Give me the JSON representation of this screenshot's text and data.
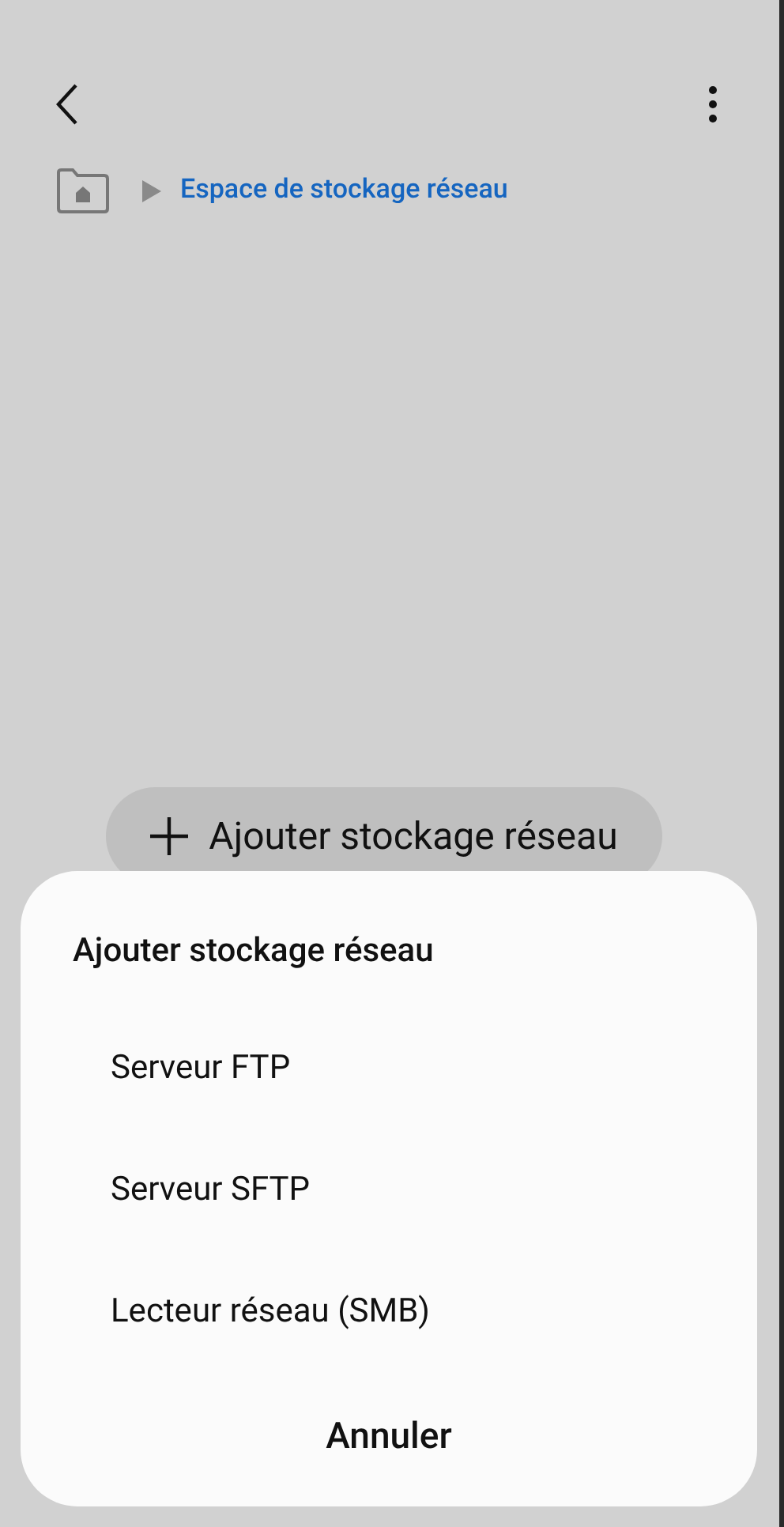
{
  "breadcrumb": {
    "current": "Espace de stockage réseau"
  },
  "add_button": {
    "label": "Ajouter stockage réseau"
  },
  "sheet": {
    "title": "Ajouter stockage réseau",
    "options": [
      "Serveur FTP",
      "Serveur SFTP",
      "Lecteur réseau (SMB)"
    ],
    "cancel": "Annuler"
  }
}
